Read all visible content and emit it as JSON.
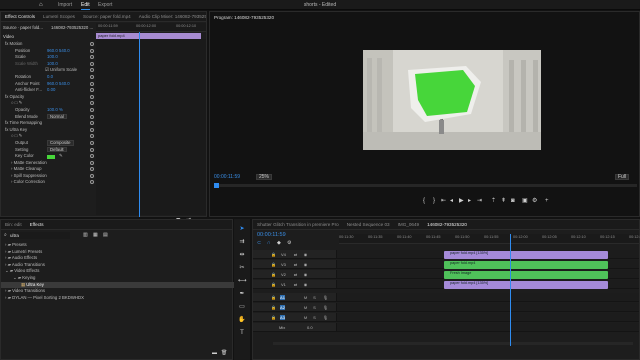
{
  "app": {
    "title": "shorts - Edited",
    "menu": [
      "Import",
      "Edit",
      "Export"
    ],
    "active_menu": "Edit"
  },
  "source_panel": {
    "tabs": [
      "Effect Controls",
      "Lumetri Scopes",
      "Source: paper fold.mp4",
      "Audio Clip Mixer: 146082-793525320"
    ],
    "header_source": "Source ∙ paper fold...",
    "header_seq": "146082-793525320 ...",
    "timecodes": [
      "00:00:11:59",
      "00:00:12:00",
      "00:00:12:10"
    ],
    "clip_label": "paper fold.mp4",
    "section": "Video",
    "rows": [
      {
        "label": "fx  Motion",
        "value": "",
        "indent": 4
      },
      {
        "label": "Position",
        "value": "960.0    540.0",
        "indent": 14
      },
      {
        "label": "Scale",
        "value": "100.0",
        "indent": 14
      },
      {
        "label": "Scale Width",
        "value": "100.0",
        "indent": 14,
        "dim": true
      },
      {
        "label": "☑ Uniform Scale",
        "value": "",
        "indent": 44
      },
      {
        "label": "Rotation",
        "value": "0.0",
        "indent": 14
      },
      {
        "label": "Anchor Point",
        "value": "960.0    540.0",
        "indent": 14
      },
      {
        "label": "Anti-flicker F...",
        "value": "0.00",
        "indent": 14
      },
      {
        "label": "fx  Opacity",
        "value": "",
        "indent": 4
      },
      {
        "label": "○ □ ✎",
        "value": "",
        "indent": 10
      },
      {
        "label": "Opacity",
        "value": "100.0 %",
        "indent": 14
      },
      {
        "label": "Blend Mode",
        "value": "Normal",
        "indent": 14,
        "dropdown": true
      },
      {
        "label": "fx  Time Remapping",
        "value": "",
        "indent": 4
      },
      {
        "label": "fx  Ultra Key",
        "value": "",
        "indent": 4
      },
      {
        "label": "○ □ ✎",
        "value": "",
        "indent": 10
      },
      {
        "label": "Output",
        "value": "Composite",
        "indent": 14,
        "dropdown": true
      },
      {
        "label": "Setting",
        "value": "Default",
        "indent": 14,
        "dropdown": true
      },
      {
        "label": "Key Color",
        "value": "",
        "indent": 14,
        "swatch": true
      },
      {
        "label": "› Matte Generation",
        "value": "",
        "indent": 10
      },
      {
        "label": "› Matte Cleanup",
        "value": "",
        "indent": 10
      },
      {
        "label": "› Spill Suppression",
        "value": "",
        "indent": 10
      },
      {
        "label": "› Color Correction",
        "value": "",
        "indent": 10
      }
    ],
    "footer_time": "00:00:11:59"
  },
  "program_panel": {
    "title": "Program: 146082-793525320",
    "timecode": "00:00:11:59",
    "zoom": "25%",
    "quality": "Full",
    "duration": "00:00:15:02"
  },
  "effects_panel": {
    "tabs": [
      "Bin: edit",
      "Effects"
    ],
    "search_value": "ultra",
    "tree": [
      {
        "label": "Presets",
        "indent": 4,
        "folder": true
      },
      {
        "label": "Lumetri Presets",
        "indent": 4,
        "folder": true
      },
      {
        "label": "Audio Effects",
        "indent": 4,
        "folder": true
      },
      {
        "label": "Audio Transitions",
        "indent": 4,
        "folder": true
      },
      {
        "label": "Video Effects",
        "indent": 4,
        "folder": true,
        "open": true
      },
      {
        "label": "Keying",
        "indent": 12,
        "folder": true,
        "open": true
      },
      {
        "label": "Ultra Key",
        "indent": 20,
        "selected": true
      },
      {
        "label": "Video Transitions",
        "indent": 4,
        "folder": true
      },
      {
        "label": "DYLAN — Pixel Sorting 2 BKDWHDX",
        "indent": 4,
        "folder": true
      }
    ]
  },
  "timeline": {
    "tabs": [
      "Shutter Glitch Transition in premiere Pro",
      "Nested Sequence 03",
      "IMG_0649",
      "146082-793525320"
    ],
    "timecode": "00:00:11:59",
    "ticks": [
      "00:11:30",
      "00:11:35",
      "00:11:40",
      "00:11:45",
      "00:11:50",
      "00:11:55",
      "00:12:00",
      "00:12:05",
      "00:12:10",
      "00:12:15",
      "00:12:20"
    ],
    "video_tracks": [
      {
        "name": "V4",
        "clip": "paper fold.mp4 [135%]",
        "color": "purple"
      },
      {
        "name": "V3",
        "clip": "paper fold.mp4",
        "color": "green"
      },
      {
        "name": "V2",
        "clip": "Fresh Image",
        "color": "green"
      },
      {
        "name": "V1",
        "clip": "paper fold.mp4 [135%]",
        "color": "purple"
      }
    ],
    "audio_tracks": [
      "A1",
      "A2",
      "A3"
    ],
    "mix_label": "Mix",
    "mix_value": "0.0"
  },
  "colors": {
    "accent": "#2d8ceb",
    "clip_purple": "#a48ad8",
    "clip_green": "#4fc15a",
    "key_green": "#47d63a"
  }
}
